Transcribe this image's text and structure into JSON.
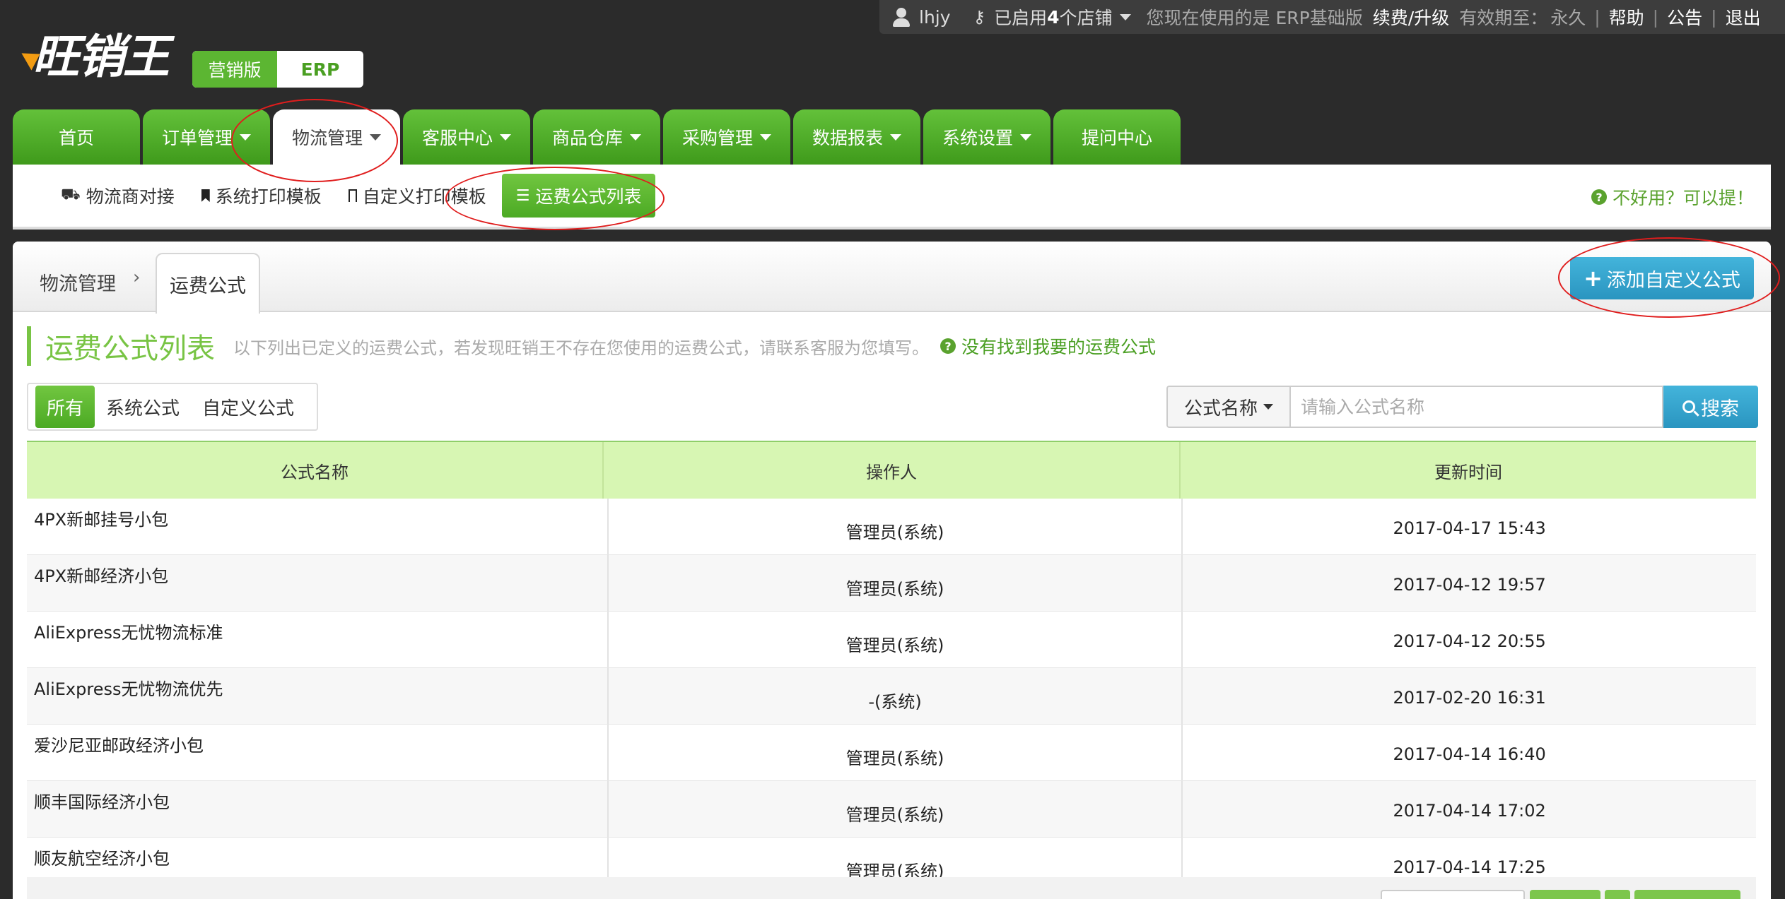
{
  "topbar": {
    "username": "lhjy",
    "shops_prefix": "已启用",
    "shops_count": "4",
    "shops_suffix": "个店铺",
    "version_text": "您现在使用的是 ERP基础版",
    "renew": "续费/升级",
    "expiry_label": "有效期至：",
    "expiry_value": "永久",
    "help": "帮助",
    "notice": "公告",
    "logout": "退出"
  },
  "logo": {
    "text": "旺销王"
  },
  "edition": {
    "marketing": "营销版",
    "erp": "ERP"
  },
  "nav": {
    "tabs": [
      {
        "label": "首页",
        "caret": false,
        "active": false
      },
      {
        "label": "订单管理",
        "caret": true,
        "active": false
      },
      {
        "label": "物流管理",
        "caret": true,
        "active": true
      },
      {
        "label": "客服中心",
        "caret": true,
        "active": false
      },
      {
        "label": "商品仓库",
        "caret": true,
        "active": false
      },
      {
        "label": "采购管理",
        "caret": true,
        "active": false
      },
      {
        "label": "数据报表",
        "caret": true,
        "active": false
      },
      {
        "label": "系统设置",
        "caret": true,
        "active": false
      },
      {
        "label": "提问中心",
        "caret": false,
        "active": false
      }
    ]
  },
  "subnav": {
    "items": [
      {
        "label": "物流商对接",
        "icon": "truck-icon"
      },
      {
        "label": "系统打印模板",
        "icon": "bookmark-icon"
      },
      {
        "label": "自定义打印模板",
        "icon": "bookmark-outline-icon"
      },
      {
        "label": "运费公式列表",
        "icon": "list-icon"
      }
    ],
    "help": "不好用？可以提！"
  },
  "breadcrumb": {
    "parent": "物流管理",
    "sep": "›",
    "current": "运费公式"
  },
  "add_button": {
    "label": "添加自定义公式"
  },
  "page": {
    "title": "运费公式列表",
    "description": "以下列出已定义的运费公式，若发现旺销王不存在您使用的运费公式，请联系客服为您填写。",
    "missing_link": "没有找到我要的运费公式"
  },
  "filters": {
    "items": [
      "所有",
      "系统公式",
      "自定义公式"
    ],
    "active": "所有"
  },
  "search": {
    "field": "公式名称",
    "placeholder": "请输入公式名称",
    "button": "搜索"
  },
  "table": {
    "columns": [
      "公式名称",
      "操作人",
      "更新时间"
    ],
    "rows": [
      {
        "name": "4PX新邮挂号小包",
        "operator": "管理员(系统)",
        "updated": "2017-04-17 15:43"
      },
      {
        "name": "4PX新邮经济小包",
        "operator": "管理员(系统)",
        "updated": "2017-04-12 19:57"
      },
      {
        "name": "AliExpress无忧物流标准",
        "operator": "管理员(系统)",
        "updated": "2017-04-12 20:55"
      },
      {
        "name": "AliExpress无忧物流优先",
        "operator": "-(系统)",
        "updated": "2017-02-20 16:31"
      },
      {
        "name": "爱沙尼亚邮政经济小包",
        "operator": "管理员(系统)",
        "updated": "2017-04-14 16:40"
      },
      {
        "name": "顺丰国际经济小包",
        "operator": "管理员(系统)",
        "updated": "2017-04-14 17:02"
      },
      {
        "name": "顺友航空经济小包",
        "operator": "管理员(系统)",
        "updated": "2017-04-14 17:25"
      }
    ]
  },
  "colors": {
    "brand_green": "#5cb632",
    "header_green": "#d7f6b3",
    "action_blue": "#2a95c0",
    "annotation_red": "#e01d1d"
  }
}
